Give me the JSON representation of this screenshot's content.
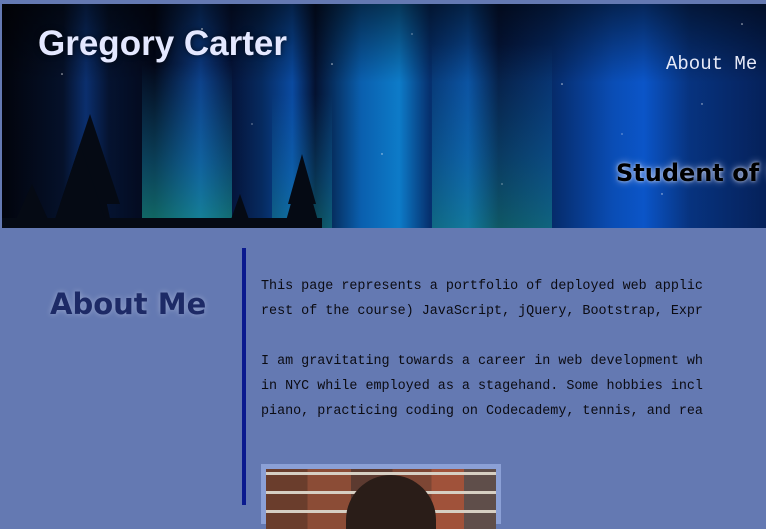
{
  "header": {
    "site_title": "Gregory Carter",
    "nav": {
      "about_label": "About Me"
    },
    "tagline": "Student of U"
  },
  "about": {
    "heading": "About Me",
    "paragraphs": [
      [
        "This page represents a portfolio of deployed web applic",
        "rest of the course) JavaScript, jQuery, Bootstrap, Expr"
      ],
      [
        "I am gravitating towards a career in web development wh",
        "in NYC while employed as a stagehand. Some hobbies incl",
        "piano, practicing coding on Codecademy, tennis, and rea"
      ]
    ]
  },
  "colors": {
    "page_background": "#6479b2",
    "heading": "#1d2a66",
    "divider": "#0a1a8f"
  },
  "icons": {
    "header_image": "aurora-night-sky",
    "profile_photo": "portrait-photo"
  }
}
